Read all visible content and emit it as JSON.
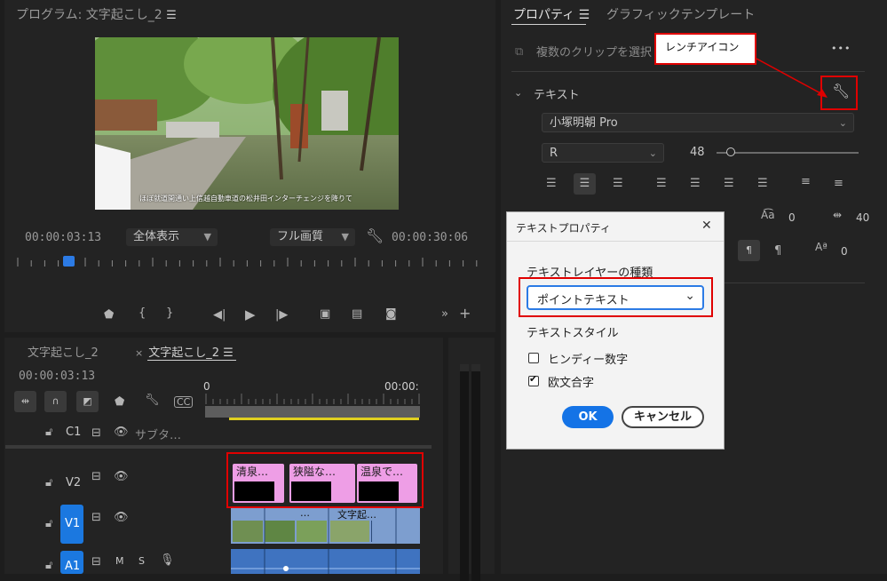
{
  "program": {
    "title": "プログラム: 文字起こし_2",
    "timecode_current": "00:00:03:13",
    "zoom_label": "全体表示",
    "quality_label": "フル画質",
    "timecode_duration": "00:00:30:06",
    "subtitle": "ほぼ就道開通い上信越自動車道の松井田インターチェンジを降りて"
  },
  "timeline": {
    "tab_inactive": "文字起こし_2",
    "tab_active": "文字起こし_2",
    "close_glyph": "×",
    "timecode": "00:00:03:13",
    "ruler_start": "0",
    "ruler_end": "00:00:",
    "tracks": {
      "c1": {
        "name": "C1",
        "label": "サブタ…"
      },
      "v2": {
        "name": "V2"
      },
      "v1": {
        "name": "V1"
      },
      "a1": {
        "name": "A1",
        "m": "M",
        "s": "S"
      }
    },
    "v2_clips": [
      "清泉…",
      "狭隘な…",
      "温泉で…"
    ],
    "v1_clip_labels": [
      "…",
      "文字起…"
    ]
  },
  "properties": {
    "tab_active": "プロパティ",
    "tab_other": "グラフィックテンプレート",
    "multi_clip": "複数のクリップを選択",
    "more": "•••",
    "section": "テキスト",
    "font": "小塚明朝 Pro",
    "style": "R",
    "size": "48",
    "kerning": "0",
    "tracking": "40",
    "baseline": "0"
  },
  "callout": {
    "text": "レンチアイコン"
  },
  "dialog": {
    "title": "テキストプロパティ",
    "close": "✕",
    "layer_type_label": "テキストレイヤーの種類",
    "layer_type_value": "ポイントテキスト",
    "text_style_label": "テキストスタイル",
    "checkbox1": "ヒンディー数字",
    "checkbox1_checked": false,
    "checkbox2": "欧文合字",
    "checkbox2_checked": true,
    "ok": "OK",
    "cancel": "キャンセル"
  },
  "colors": {
    "accent_blue": "#2c7be5",
    "clip_pink": "#ee9ee6",
    "highlight_red": "#e00000",
    "track_blue": "#1b78e0"
  }
}
